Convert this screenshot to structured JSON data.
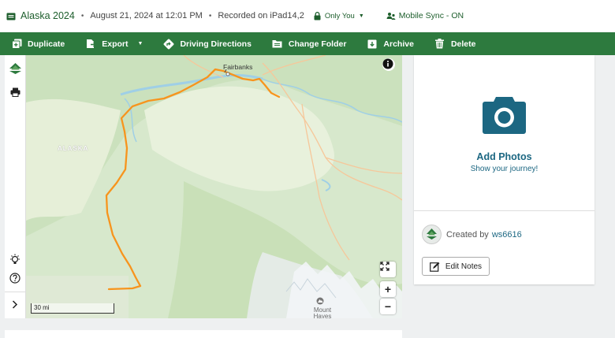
{
  "header": {
    "title": "Alaska 2024",
    "date": "August 21, 2024 at 12:01 PM",
    "recorded": "Recorded on iPad14,2",
    "privacy": "Only You",
    "sync": "Mobile Sync - ON"
  },
  "toolbar": {
    "duplicate": "Duplicate",
    "export": "Export",
    "directions": "Driving Directions",
    "change_folder": "Change Folder",
    "archive": "Archive",
    "delete": "Delete"
  },
  "map": {
    "city_label": "Fairbanks",
    "region_label": "ALASKA",
    "mountain_label": "Mount Hayes",
    "scale_label": "30 mi",
    "route_color": "#f7941d"
  },
  "panel": {
    "add_photos": "Add Photos",
    "subtitle": "Show your journey!",
    "created_by": "Created by",
    "username": "ws6616",
    "edit_notes": "Edit Notes"
  },
  "colors": {
    "brand_green": "#2d7a3e",
    "link_blue": "#1c6782"
  }
}
